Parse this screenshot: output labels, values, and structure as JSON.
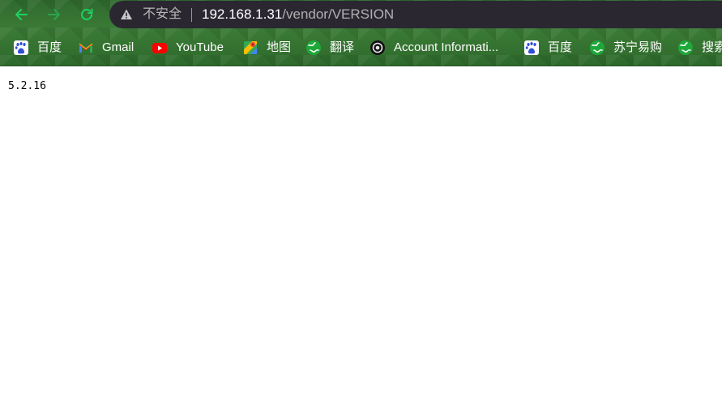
{
  "browser": {
    "security_label": "不安全",
    "url_host": "192.168.1.31",
    "url_path": "/vendor/VERSION",
    "nav_icons": [
      "back-arrow-icon",
      "forward-arrow-icon",
      "reload-icon"
    ]
  },
  "bookmarks": [
    {
      "label": "百度",
      "icon": "baidu-icon"
    },
    {
      "label": "Gmail",
      "icon": "gmail-icon"
    },
    {
      "label": "YouTube",
      "icon": "youtube-icon"
    },
    {
      "label": "地图",
      "icon": "maps-icon"
    },
    {
      "label": "翻译",
      "icon": "globe-icon"
    },
    {
      "label": "Account Informati...",
      "icon": "steam-icon"
    },
    {
      "label": "百度",
      "icon": "baidu-icon"
    },
    {
      "label": "苏宁易购",
      "icon": "globe-icon"
    },
    {
      "label": "搜索",
      "icon": "globe-icon"
    }
  ],
  "page": {
    "body_text": "5.2.16"
  },
  "colors": {
    "toolbar_green": "#3b7a36",
    "omnibox_bg": "#2b2731",
    "nav_icon_green": "#1fcf63",
    "page_bg": "#ffffff"
  }
}
